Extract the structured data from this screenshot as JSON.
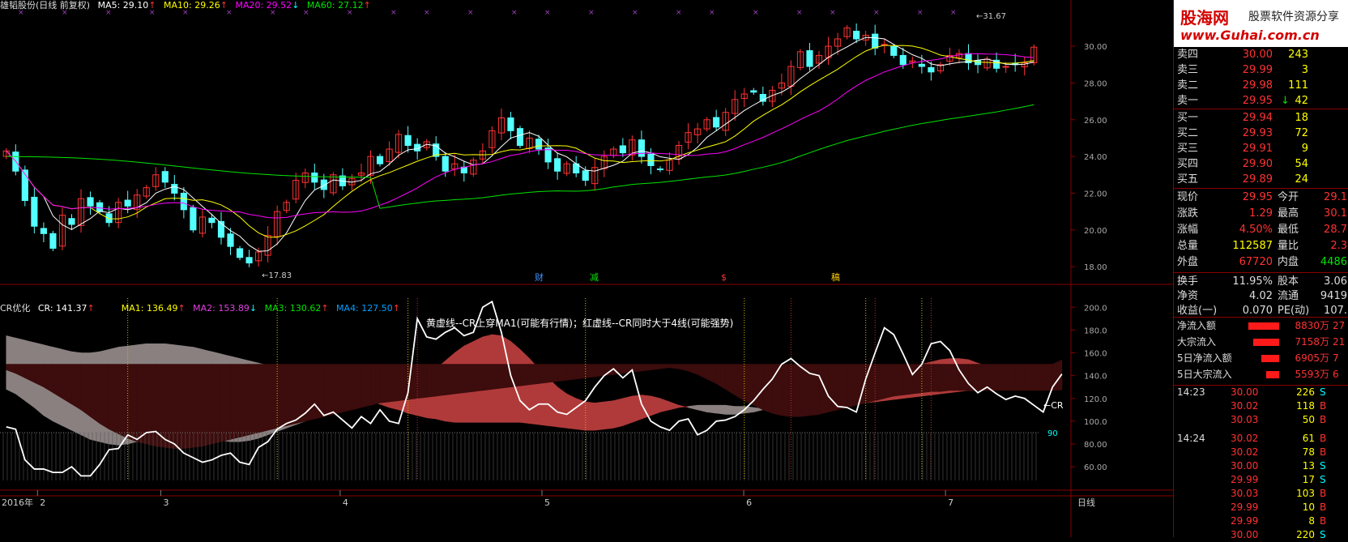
{
  "top_header": {
    "stock": "雄韬股份(日线 前复权)",
    "ma5": "MA5: 29.10",
    "ma10": "MA10: 29.26",
    "ma20": "MA20: 29.52",
    "ma60": "MA60: 27.12"
  },
  "ind_header": {
    "name": "CR优化",
    "cr": "CR: 141.37",
    "ma1": "MA1: 136.49",
    "ma2": "MA2: 153.89",
    "ma3": "MA3: 130.62",
    "ma4": "MA4: 127.50",
    "note": "黄虚线--CR上穿MA1(可能有行情)；红虚线--CR同时大于4线(可能强势)"
  },
  "colors": {
    "up": "#ff3232",
    "down": "#54ffff",
    "ma5": "#ffffff",
    "ma10": "#ffff00",
    "ma20": "#ff00ff",
    "ma60": "#00e400",
    "axis_red": "#8a0000",
    "ma2": "#e040e0",
    "ma3": "#00e400",
    "ma4": "#00a0ff"
  },
  "markers": {
    "high": "31.67",
    "low": "17.83",
    "cr_tag": "←CR",
    "level90": "90",
    "event_cai": "财",
    "event_jian": "减",
    "event_s": "$",
    "event_gao": "稿"
  },
  "xaxis": {
    "year": "2016年",
    "months": [
      "2",
      "3",
      "4",
      "5",
      "6",
      "7"
    ],
    "period": "日线"
  },
  "chart_data": [
    {
      "type": "candlestick",
      "title": "雄韬股份(日线 前复权)",
      "yticks": [
        "30.00",
        "28.00",
        "26.00",
        "24.00",
        "22.00",
        "20.00",
        "18.00"
      ],
      "ylim": [
        17.3,
        31.9
      ],
      "high_label": 31.67,
      "low_label": 17.83,
      "series": [
        {
          "name": "MA5",
          "last": 29.1
        },
        {
          "name": "MA10",
          "last": 29.26
        },
        {
          "name": "MA20",
          "last": 29.52
        },
        {
          "name": "MA60",
          "last": 27.12
        }
      ],
      "close": [
        24.3,
        23.2,
        21.6,
        20.2,
        19.8,
        19.0,
        20.8,
        20.3,
        21.7,
        21.3,
        21.0,
        20.4,
        21.5,
        21.3,
        21.9,
        22.3,
        23.0,
        22.6,
        22.0,
        21.1,
        20.0,
        20.7,
        20.4,
        19.6,
        19.1,
        18.5,
        18.2,
        18.8,
        19.7,
        21.0,
        21.5,
        22.7,
        23.1,
        22.6,
        22.2,
        23.0,
        22.4,
        22.8,
        23.1,
        24.0,
        23.6,
        24.4,
        25.2,
        24.6,
        24.3,
        24.8,
        24.0,
        23.2,
        23.6,
        23.1,
        23.8,
        24.3,
        25.4,
        26.1,
        25.4,
        24.6,
        25.0,
        24.4,
        23.7,
        23.2,
        23.6,
        23.1,
        22.7,
        23.4,
        24.0,
        24.4,
        24.2,
        24.9,
        24.0,
        23.5,
        23.3,
        23.8,
        24.6,
        25.3,
        25.5,
        26.0,
        25.6,
        26.4,
        27.1,
        27.4,
        27.5,
        27.0,
        27.6,
        28.0,
        28.9,
        29.7,
        28.9,
        29.5,
        30.0,
        30.4,
        31.0,
        30.4,
        30.6,
        29.9,
        30.1,
        29.5,
        29.0,
        29.2,
        28.9,
        28.6,
        29.0,
        29.5,
        29.6,
        29.1,
        29.0,
        29.3,
        28.8,
        28.9,
        29.0,
        29.1,
        29.95
      ],
      "xlabels": [
        "2",
        "3",
        "4",
        "5",
        "6",
        "7"
      ]
    },
    {
      "type": "area",
      "title": "CR优化",
      "yticks": [
        "200.0",
        "180.0",
        "160.0",
        "140.0",
        "120.0",
        "100.0",
        "80.00",
        "60.00"
      ],
      "ylim": [
        48,
        208
      ],
      "series": [
        {
          "name": "CR",
          "last": 141.37
        },
        {
          "name": "MA1",
          "last": 136.49
        },
        {
          "name": "MA2",
          "last": 153.89
        },
        {
          "name": "MA3",
          "last": 130.62
        },
        {
          "name": "MA4",
          "last": 127.5
        }
      ],
      "level": 90,
      "cr": [
        95,
        93,
        66,
        58,
        58,
        55,
        55,
        60,
        52,
        52,
        62,
        75,
        76,
        88,
        84,
        90,
        91,
        84,
        80,
        72,
        68,
        64,
        66,
        70,
        72,
        64,
        62,
        77,
        82,
        93,
        98,
        101,
        107,
        115,
        105,
        108,
        101,
        94,
        104,
        98,
        110,
        100,
        98,
        125,
        190,
        174,
        172,
        178,
        182,
        175,
        178,
        200,
        205,
        178,
        140,
        118,
        110,
        115,
        115,
        108,
        106,
        112,
        118,
        130,
        140,
        146,
        138,
        145,
        115,
        100,
        95,
        92,
        100,
        102,
        88,
        92,
        100,
        101,
        104,
        110,
        118,
        128,
        137,
        150,
        155,
        148,
        142,
        140,
        122,
        113,
        112,
        108,
        137,
        160,
        182,
        176,
        159,
        141,
        150,
        168,
        170,
        162,
        145,
        133,
        125,
        130,
        124,
        119,
        122,
        120,
        114,
        108,
        130,
        141.37
      ],
      "ma1": [
        128,
        124,
        118,
        112,
        105,
        100,
        96,
        92,
        88,
        84,
        82,
        80,
        79,
        80,
        82,
        84,
        86,
        88,
        89,
        90,
        89,
        87,
        85,
        83,
        82,
        82,
        83,
        85,
        88,
        91,
        94,
        97,
        100,
        104,
        107,
        110,
        111,
        113,
        114,
        115,
        117,
        118,
        120,
        124,
        130,
        138,
        146,
        153,
        160,
        166,
        170,
        174,
        176,
        175,
        170,
        163,
        155,
        146,
        138,
        130,
        124,
        120,
        117,
        116,
        117,
        118,
        120,
        122,
        123,
        122,
        120,
        117,
        114,
        112,
        110,
        108,
        107,
        106,
        106,
        107,
        108,
        110,
        113,
        117,
        121,
        125,
        128,
        131,
        133,
        133,
        132,
        131,
        131,
        133,
        137,
        141,
        145,
        148,
        150,
        152,
        154,
        155,
        155,
        154,
        151,
        148,
        145,
        142,
        139,
        137,
        135,
        134,
        135,
        136.49
      ],
      "ma2": [
        150,
        150,
        150,
        150,
        150,
        150,
        150,
        150,
        150,
        150,
        150,
        150,
        150,
        150,
        150,
        150,
        150,
        150,
        150,
        150,
        150,
        150,
        150,
        150,
        150,
        150,
        150,
        150,
        150,
        150,
        150,
        150,
        150,
        150,
        150,
        150,
        150,
        150,
        150,
        150,
        150,
        150,
        150,
        150,
        150,
        150,
        150,
        150,
        150,
        150,
        150,
        150,
        150,
        150,
        150,
        150,
        150,
        150,
        150,
        150,
        150,
        150,
        150,
        150,
        150,
        150,
        150,
        150,
        150,
        150,
        150,
        150,
        150,
        150,
        150,
        150,
        150,
        150,
        150,
        150,
        150,
        150,
        150,
        150,
        150,
        150,
        150,
        150,
        150,
        150,
        150,
        150,
        150,
        150,
        150,
        150,
        150,
        150,
        150,
        150,
        150,
        150,
        150,
        150,
        150,
        150,
        150,
        150,
        150,
        150,
        150,
        150,
        150,
        153.89
      ],
      "ma3": [
        175,
        173,
        171,
        169,
        167,
        165,
        163,
        161,
        160,
        160,
        161,
        163,
        165,
        166,
        167,
        168,
        168,
        168,
        167,
        166,
        165,
        163,
        161,
        159,
        157,
        155,
        153,
        151,
        149,
        147,
        145,
        142,
        140,
        137,
        134,
        131,
        128,
        125,
        122,
        118,
        115,
        112,
        110,
        107,
        105,
        103,
        102,
        100,
        99,
        99,
        99,
        99,
        99,
        99,
        99,
        99,
        98,
        97,
        96,
        95,
        94,
        93,
        92,
        92,
        93,
        94,
        96,
        99,
        102,
        105,
        108,
        110,
        112,
        113,
        114,
        114,
        114,
        114,
        113,
        113,
        112,
        111,
        111,
        111,
        112,
        112,
        113,
        113,
        114,
        114,
        114,
        115,
        116,
        117,
        118,
        119,
        120,
        121,
        122,
        123,
        124,
        125,
        126,
        127,
        127,
        128,
        129,
        129,
        130,
        130,
        130,
        130,
        130,
        130.62
      ],
      "ma4": [
        145,
        142,
        138,
        134,
        130,
        125,
        120,
        115,
        110,
        104,
        98,
        93,
        89,
        85,
        82,
        80,
        78,
        77,
        76,
        76,
        77,
        78,
        80,
        82,
        84,
        86,
        88,
        90,
        92,
        94,
        96,
        98,
        100,
        102,
        104,
        106,
        108,
        110,
        112,
        114,
        116,
        117,
        118,
        119,
        120,
        121,
        122,
        123,
        124,
        125,
        126,
        127,
        128,
        129,
        130,
        131,
        132,
        133,
        134,
        135,
        136,
        137,
        138,
        139,
        140,
        141,
        142,
        143,
        144,
        145,
        146,
        147,
        146,
        144,
        141,
        137,
        133,
        128,
        123,
        118,
        114,
        110,
        107,
        105,
        104,
        104,
        105,
        106,
        108,
        110,
        112,
        114,
        116,
        118,
        120,
        122,
        123,
        124,
        125,
        126,
        126,
        127,
        127,
        127,
        127,
        127,
        127,
        127,
        127,
        127,
        127,
        127,
        127,
        127.5
      ]
    }
  ],
  "quote": {
    "ask": [
      {
        "label": "卖四",
        "price": "30.00",
        "vol": "243"
      },
      {
        "label": "卖三",
        "price": "29.99",
        "vol": "3"
      },
      {
        "label": "卖二",
        "price": "29.98",
        "vol": "111"
      },
      {
        "label": "卖一",
        "price": "29.95",
        "vol": "42",
        "arrow": "↓"
      }
    ],
    "bid": [
      {
        "label": "买一",
        "price": "29.94",
        "vol": "18"
      },
      {
        "label": "买二",
        "price": "29.93",
        "vol": "72"
      },
      {
        "label": "买三",
        "price": "29.91",
        "vol": "9"
      },
      {
        "label": "买四",
        "price": "29.90",
        "vol": "54"
      },
      {
        "label": "买五",
        "price": "29.89",
        "vol": "24"
      }
    ],
    "stats": [
      {
        "l1": "现价",
        "v1": "29.95",
        "l2": "今开",
        "v2": "29.1"
      },
      {
        "l1": "涨跌",
        "v1": "1.29",
        "l2": "最高",
        "v2": "30.1"
      },
      {
        "l1": "涨幅",
        "v1": "4.50%",
        "l2": "最低",
        "v2": "28.7"
      },
      {
        "l1": "总量",
        "v1": "112587",
        "l2": "量比",
        "v2": "2.3"
      },
      {
        "l1": "外盘",
        "v1": "67720",
        "l2": "内盘",
        "v2": "4486"
      }
    ],
    "stats2": [
      {
        "l1": "换手",
        "v1": "11.95%",
        "l2": "股本",
        "v2": "3.06"
      },
      {
        "l1": "净资",
        "v1": "4.02",
        "l2": "流通",
        "v2": "9419"
      },
      {
        "l1": "收益(一)",
        "v1": "0.070",
        "l2": "PE(动)",
        "v2": "107."
      }
    ],
    "flows": [
      {
        "label": "净流入额",
        "value": "8830万",
        "extra": "27"
      },
      {
        "label": "大宗流入",
        "value": "7158万",
        "extra": "21"
      },
      {
        "label": "5日净流入额",
        "value": "6905万",
        "extra": "7"
      },
      {
        "label": "5日大宗流入",
        "value": "5593万",
        "extra": "6"
      }
    ],
    "ticks": [
      {
        "time": "14:23",
        "price": "30.00",
        "vol": "226",
        "dir": "S"
      },
      {
        "time": "",
        "price": "30.02",
        "vol": "118",
        "dir": "B"
      },
      {
        "time": "",
        "price": "30.03",
        "vol": "50",
        "dir": "B"
      },
      {
        "time": "14:24",
        "price": "30.02",
        "vol": "61",
        "dir": "B"
      },
      {
        "time": "",
        "price": "30.02",
        "vol": "78",
        "dir": "B"
      },
      {
        "time": "",
        "price": "30.00",
        "vol": "13",
        "dir": "S"
      },
      {
        "time": "",
        "price": "29.99",
        "vol": "17",
        "dir": "S"
      },
      {
        "time": "",
        "price": "30.03",
        "vol": "103",
        "dir": "B"
      },
      {
        "time": "",
        "price": "29.99",
        "vol": "10",
        "dir": "B"
      },
      {
        "time": "",
        "price": "29.99",
        "vol": "8",
        "dir": "B"
      },
      {
        "time": "",
        "price": "30.00",
        "vol": "220",
        "dir": "S"
      }
    ]
  },
  "logo": {
    "main": "股海网",
    "sub": "股票软件资源分享",
    "url": "www.Guhai.com.cn"
  }
}
